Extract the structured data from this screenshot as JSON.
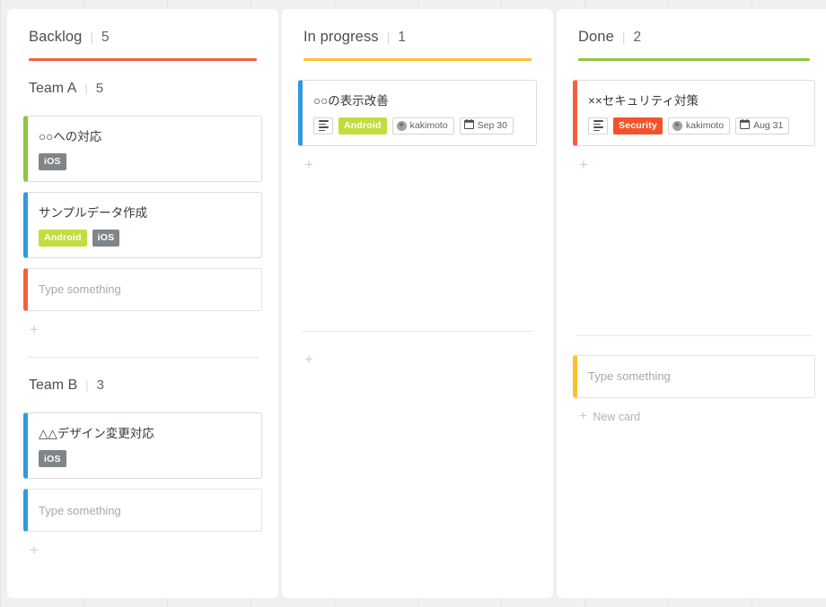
{
  "board": {
    "columns": [
      {
        "id": "backlog",
        "title": "Backlog",
        "separator": "|",
        "count": "5",
        "accent": "#f4603e",
        "lanes": [
          {
            "name": "Team A",
            "separator": "|",
            "count": "5",
            "cards": [
              {
                "title": "○○への対応",
                "border_color": "#8cc63f",
                "tags": [
                  {
                    "label": "iOS",
                    "color": "#7f8589"
                  }
                ],
                "has_description": false,
                "assignee": "",
                "due": ""
              },
              {
                "title": "サンプルデータ作成",
                "border_color": "#2f9ae0",
                "tags": [
                  {
                    "label": "Android",
                    "color": "#c3dc3e"
                  },
                  {
                    "label": "iOS",
                    "color": "#7f8589"
                  }
                ],
                "has_description": false,
                "assignee": "",
                "due": ""
              }
            ],
            "input": {
              "placeholder": "Type something",
              "value": "",
              "border_color": "#f4603e"
            },
            "add_label": "+"
          },
          {
            "name": "Team B",
            "separator": "|",
            "count": "3",
            "cards": [
              {
                "title": "△△デザイン変更対応",
                "border_color": "#2f9ae0",
                "tags": [
                  {
                    "label": "iOS",
                    "color": "#7f8589"
                  }
                ],
                "has_description": false,
                "assignee": "",
                "due": ""
              }
            ],
            "input": {
              "placeholder": "Type something",
              "value": "",
              "border_color": "#2f9ae0"
            },
            "add_label": "+"
          }
        ]
      },
      {
        "id": "in-progress",
        "title": "In progress",
        "separator": "|",
        "count": "1",
        "accent": "#fbc02d",
        "lanes": [
          {
            "name": "",
            "separator": "",
            "count": "",
            "cards": [
              {
                "title": "○○の表示改善",
                "border_color": "#2f9ae0",
                "tags": [
                  {
                    "label": "Android",
                    "color": "#c3dc3e"
                  }
                ],
                "has_description": true,
                "assignee": "kakimoto",
                "due": "Sep 30"
              }
            ],
            "input": null,
            "add_label": "+"
          },
          {
            "name": "",
            "separator": "",
            "count": "",
            "cards": [],
            "input": null,
            "add_label": "+"
          }
        ]
      },
      {
        "id": "done",
        "title": "Done",
        "separator": "|",
        "count": "2",
        "accent": "#8cc63f",
        "lanes": [
          {
            "name": "",
            "separator": "",
            "count": "",
            "cards": [
              {
                "title": "××セキュリティ対策",
                "border_color": "#f4603e",
                "tags": [
                  {
                    "label": "Security",
                    "color": "#f4522a"
                  }
                ],
                "has_description": true,
                "assignee": "kakimoto",
                "due": "Aug 31"
              }
            ],
            "input": null,
            "add_label": "+"
          },
          {
            "name": "",
            "separator": "",
            "count": "",
            "cards": [],
            "input": {
              "placeholder": "Type something",
              "value": "",
              "border_color": "#fbc02d"
            },
            "add_label": "New card"
          }
        ]
      }
    ]
  },
  "icons": {
    "description": "description-icon",
    "calendar": "calendar-icon",
    "avatar": "avatar-icon",
    "plus": "plus-icon"
  }
}
